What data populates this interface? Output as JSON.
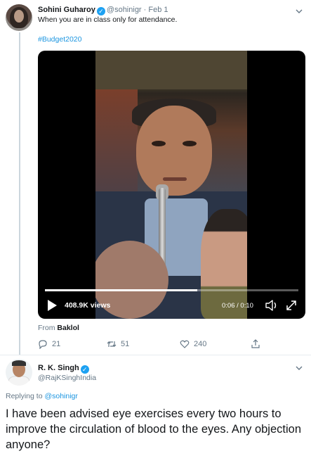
{
  "tweet1": {
    "author_name": "Sohini Guharoy",
    "handle": "@sohinigr",
    "separator": "·",
    "date": "Feb 1",
    "text": "When you are in class only for attendance.",
    "hashtag": "#Budget2020",
    "video": {
      "views": "408.9K views",
      "time": "0:06 / 0:10",
      "progress": 0.6
    },
    "from_label": "From",
    "from_source": "Baklol",
    "actions": {
      "replies": "21",
      "retweets": "51",
      "likes": "240"
    }
  },
  "tweet2": {
    "author_name": "R. K. Singh",
    "handle": "@RajKSinghIndia",
    "replying_label": "Replying to",
    "replying_to": "@sohinigr",
    "text": "I have been advised eye exercises every two hours to improve the circulation of blood to the eyes. Any objection anyone?"
  },
  "icons": {
    "verified": "verified-badge-icon",
    "chevron": "chevron-down-icon",
    "reply": "reply-icon",
    "retweet": "retweet-icon",
    "like": "heart-icon",
    "share": "share-icon",
    "play": "play-icon",
    "volume": "volume-icon",
    "fullscreen": "fullscreen-icon"
  },
  "colors": {
    "link": "#1b95e0",
    "verified": "#1da1f2",
    "muted": "#657786",
    "text": "#14171a"
  }
}
